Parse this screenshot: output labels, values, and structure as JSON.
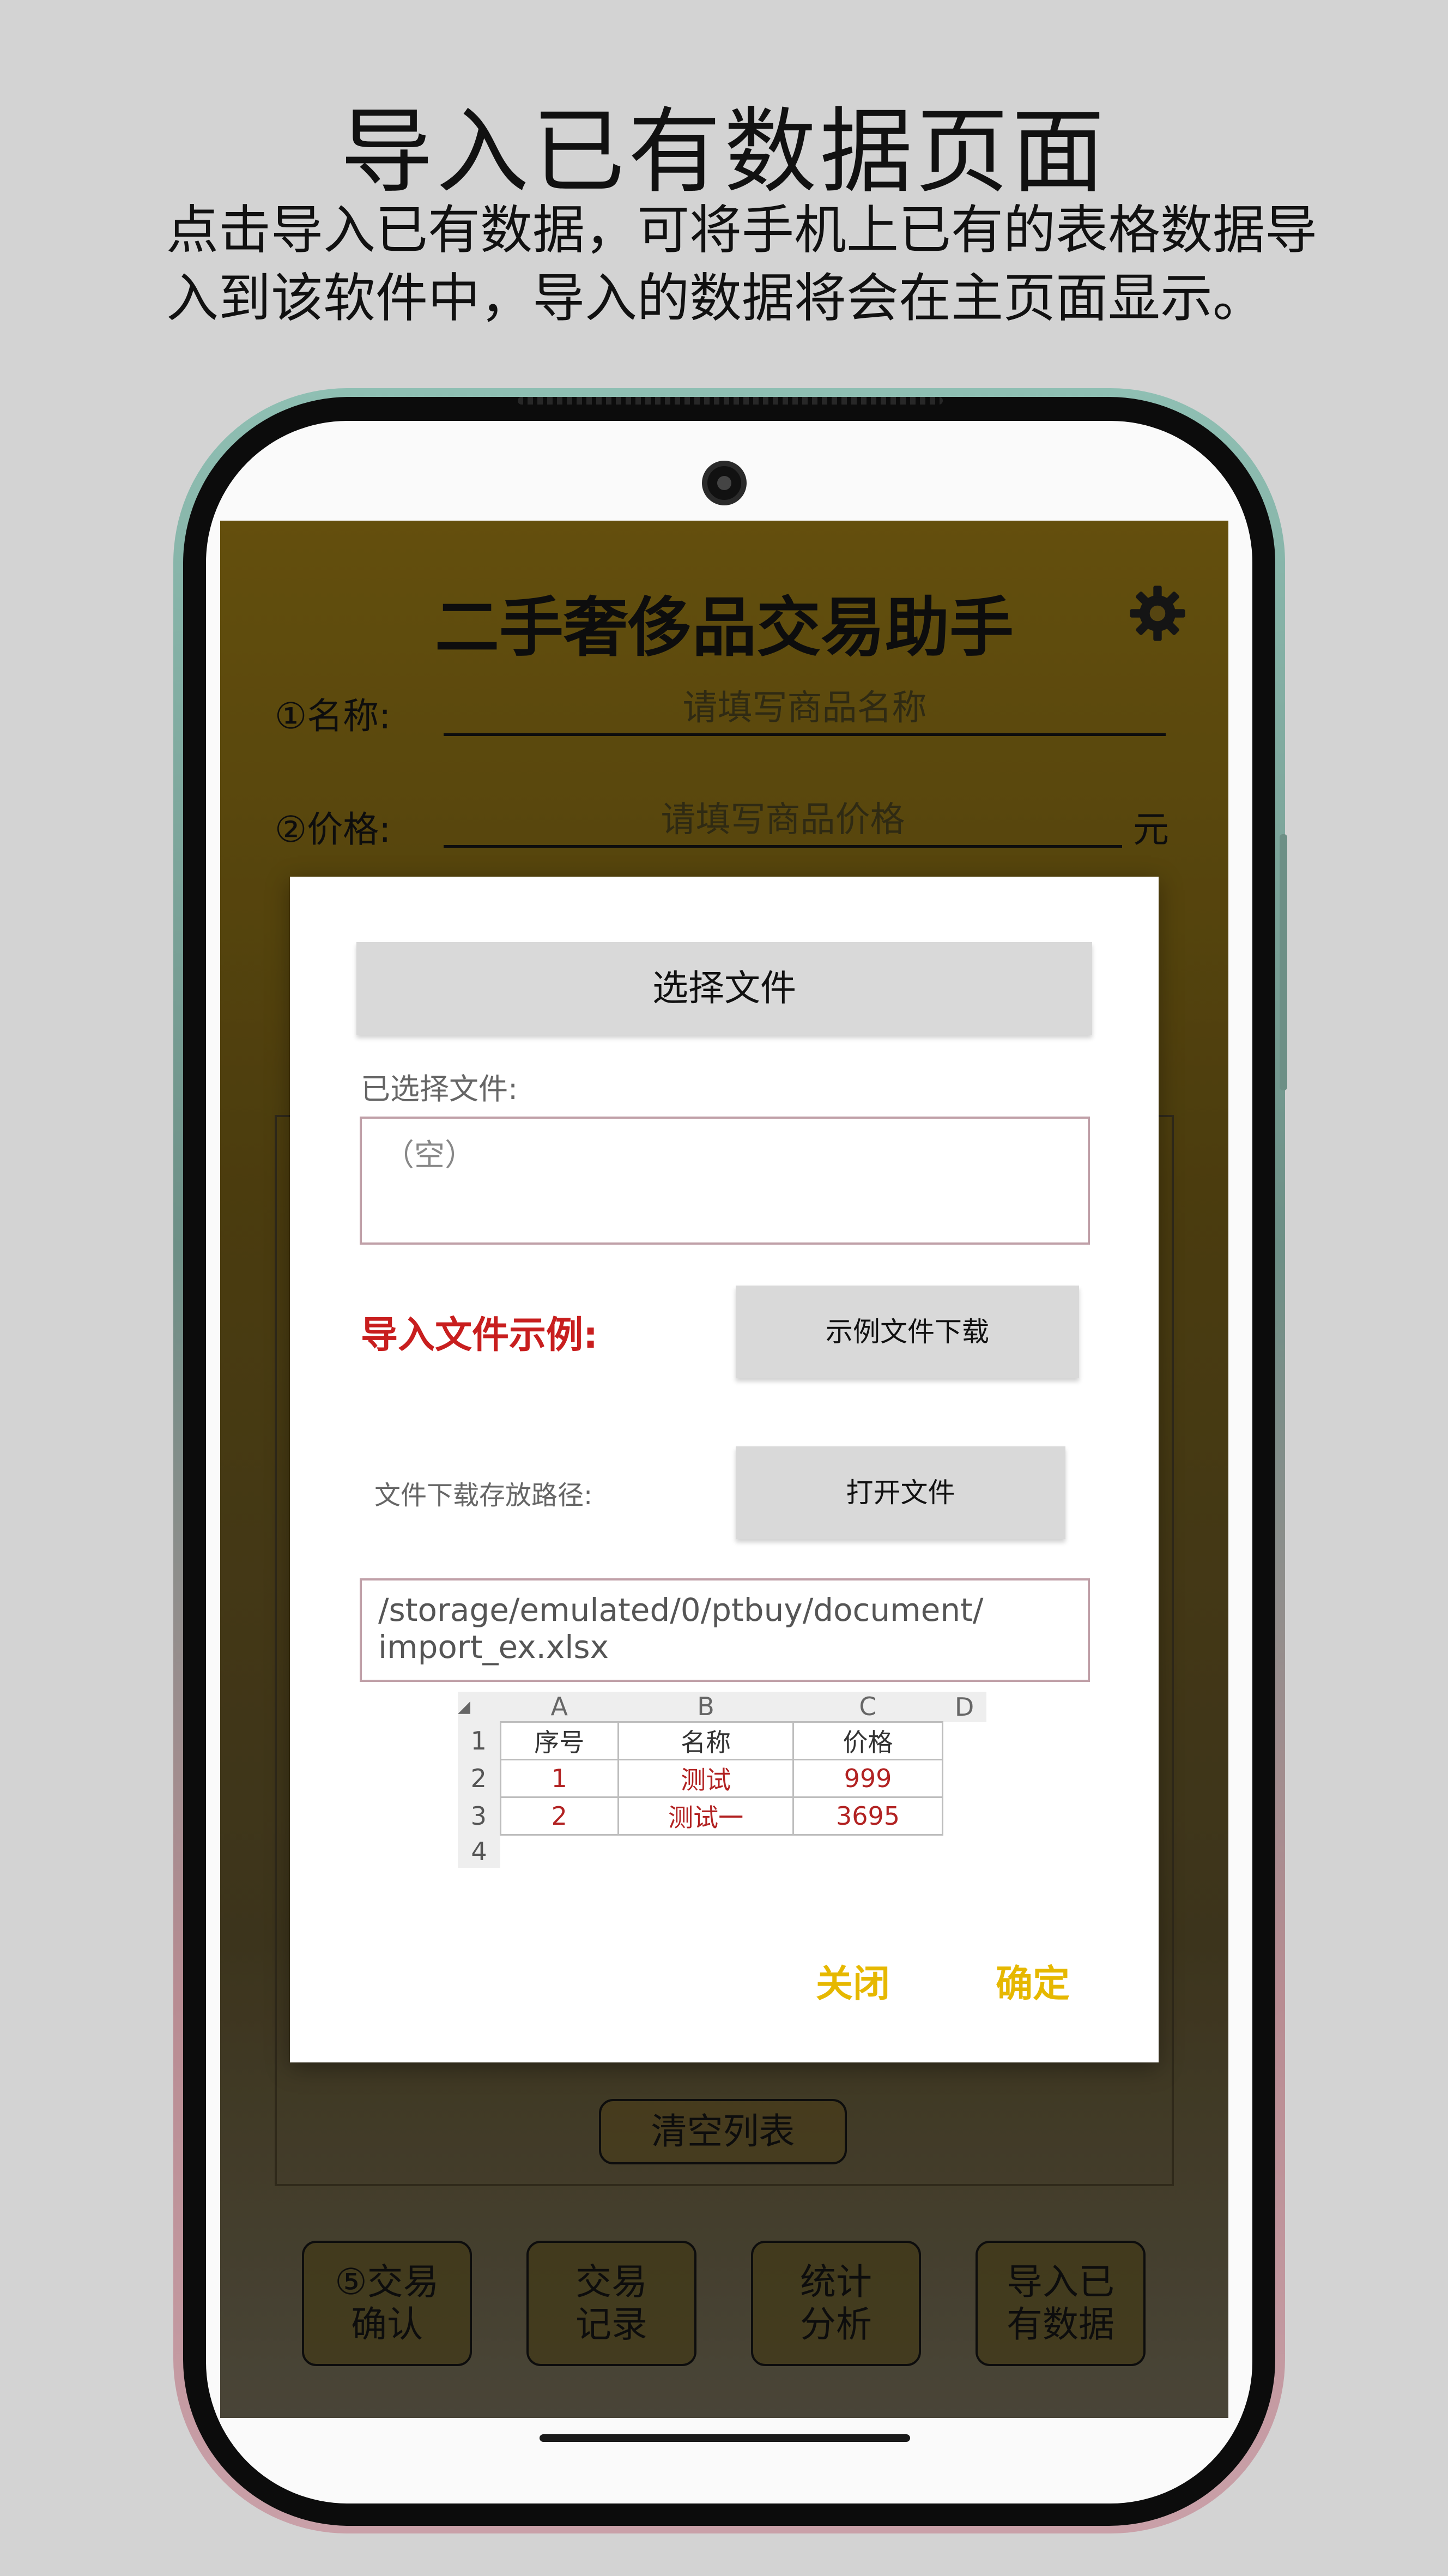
{
  "promo": {
    "title": "导入已有数据页面",
    "description": "点击导入已有数据，可将手机上已有的表格数据导入到该软件中，导入的数据将会在主页面显示。"
  },
  "app": {
    "title": "二手奢侈品交易助手",
    "settings_icon": "gear-icon",
    "name_label": "①名称:",
    "name_placeholder": "请填写商品名称",
    "price_label": "②价格:",
    "price_placeholder": "请填写商品价格",
    "price_unit": "元",
    "clear_list": "清空列表",
    "nav": [
      {
        "label": "⑤交易\n确认"
      },
      {
        "label": "交易\n记录"
      },
      {
        "label": "统计\n分析"
      },
      {
        "label": "导入已\n有数据"
      }
    ]
  },
  "dialog": {
    "choose_file": "选择文件",
    "selected_label": "已选择文件:",
    "selected_value": "（空）",
    "example_label": "导入文件示例:",
    "download_example": "示例文件下载",
    "download_path_label": "文件下载存放路径:",
    "open_file": "打开文件",
    "path_value": "/storage/emulated/0/ptbuy/document/\nimport_ex.xlsx",
    "sheet": {
      "columns": [
        "A",
        "B",
        "C",
        "D"
      ],
      "row_numbers": [
        "1",
        "2",
        "3",
        "4"
      ],
      "header": [
        "序号",
        "名称",
        "价格"
      ],
      "rows": [
        [
          "1",
          "测试",
          "999"
        ],
        [
          "2",
          "测试一",
          "3695"
        ]
      ]
    },
    "close": "关闭",
    "confirm": "确定"
  },
  "colors": {
    "accent_yellow": "#e6b800",
    "example_red": "#c81e1e",
    "screen_brown": "#7a6110"
  }
}
